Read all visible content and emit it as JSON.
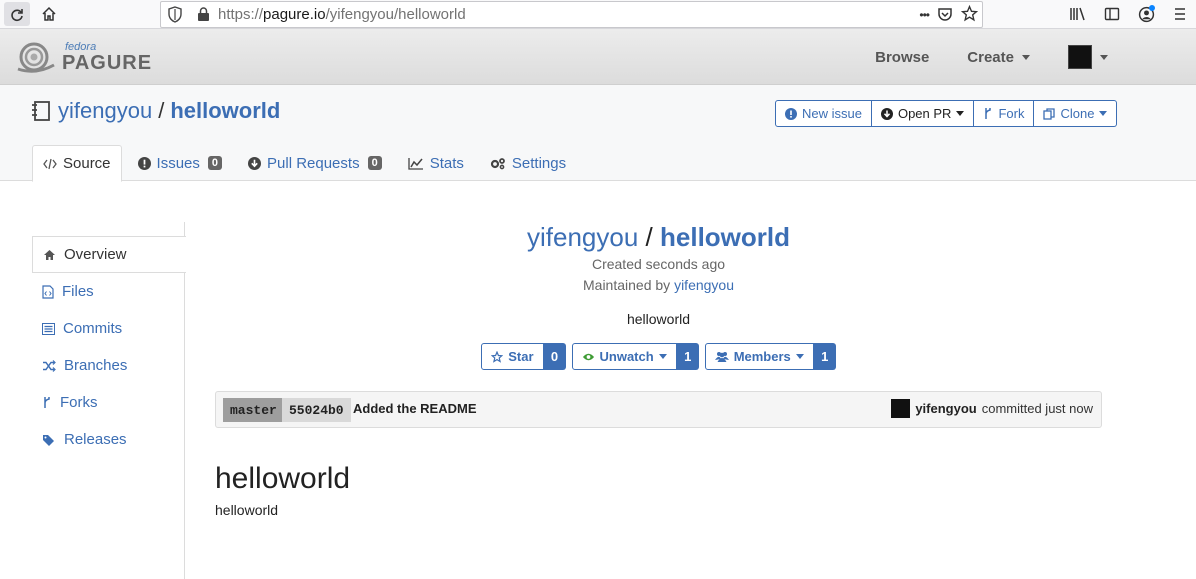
{
  "browser": {
    "url_prefix": "https://",
    "url_domain": "pagure.io",
    "url_path": "/yifengyou/helloworld",
    "more_label": "•••"
  },
  "topnav": {
    "logo_fedora": "fedora",
    "logo_pagure": "PAGURE",
    "browse_label": "Browse",
    "create_label": "Create"
  },
  "repo": {
    "namespace": "yifengyou",
    "separator": "/",
    "name": "helloworld",
    "actions": {
      "new_issue": "New issue",
      "open_pr": "Open PR",
      "fork": "Fork",
      "clone": "Clone"
    },
    "tabs": [
      {
        "label": "Source"
      },
      {
        "label": "Issues",
        "count": "0"
      },
      {
        "label": "Pull Requests",
        "count": "0"
      },
      {
        "label": "Stats"
      },
      {
        "label": "Settings"
      }
    ]
  },
  "sidebar": {
    "items": [
      {
        "label": "Overview",
        "icon": "home-icon"
      },
      {
        "label": "Files",
        "icon": "file-code-icon"
      },
      {
        "label": "Commits",
        "icon": "list-icon"
      },
      {
        "label": "Branches",
        "icon": "random-icon"
      },
      {
        "label": "Forks",
        "icon": "fork-icon"
      },
      {
        "label": "Releases",
        "icon": "tags-icon"
      }
    ]
  },
  "main": {
    "namespace": "yifengyou",
    "separator": "/",
    "name": "helloworld",
    "created": "Created seconds ago",
    "maintained_prefix": "Maintained by",
    "maintainer": "yifengyou",
    "description": "helloworld",
    "star_label": "Star",
    "star_count": "0",
    "watch_label": "Unwatch",
    "watch_count": "1",
    "members_label": "Members",
    "members_count": "1"
  },
  "commit": {
    "branch": "master",
    "hash": "55024b0",
    "message": "Added the README",
    "author": "yifengyou",
    "time": "committed just now"
  },
  "readme": {
    "title": "helloworld",
    "body": "helloworld"
  },
  "colors": {
    "link": "#3c6eb4",
    "badge": "#666666",
    "watch_green": "#3f9c35"
  }
}
